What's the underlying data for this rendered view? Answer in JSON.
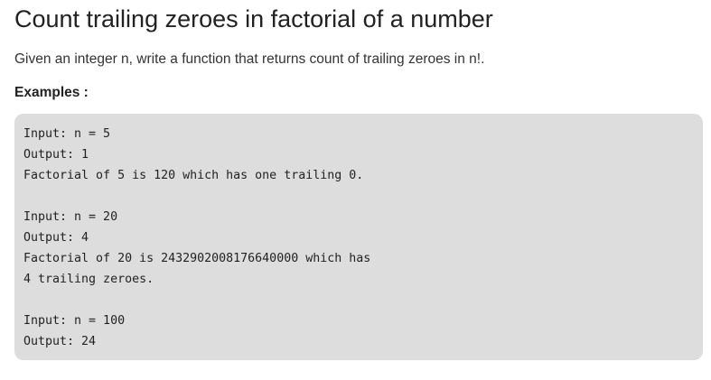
{
  "article": {
    "title": "Count trailing zeroes in factorial of a number",
    "intro": "Given an integer n, write a function that returns count of trailing zeroes in n!.",
    "examples_heading": "Examples :"
  },
  "code_example": {
    "lines": [
      "Input: n = 5",
      "Output: 1",
      "Factorial of 5 is 120 which has one trailing 0.",
      "",
      "Input: n = 20",
      "Output: 4",
      "Factorial of 20 is 2432902008176640000 which has",
      "4 trailing zeroes.",
      "",
      "Input: n = 100",
      "Output: 24"
    ]
  },
  "colors": {
    "code_background": "#dddddd",
    "text": "#222222"
  }
}
